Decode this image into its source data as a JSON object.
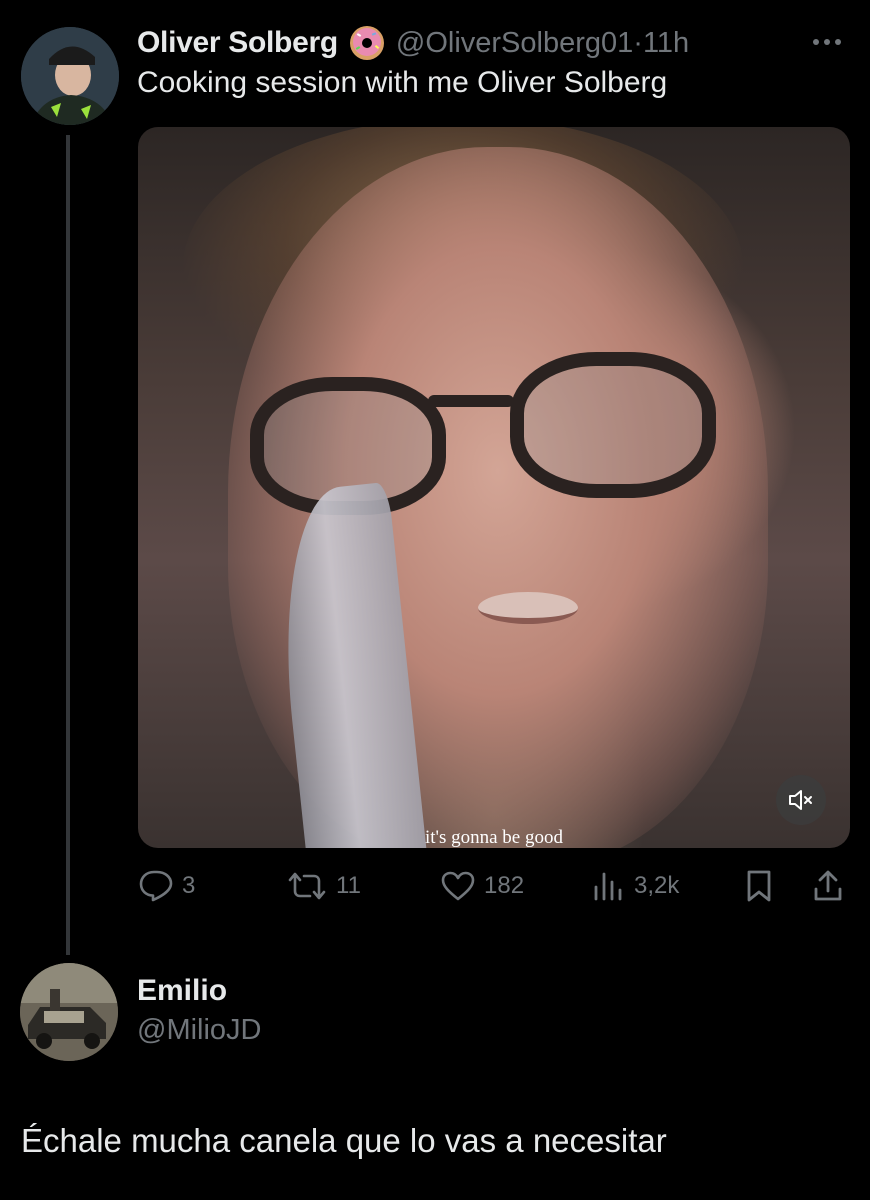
{
  "tweet": {
    "author_name": "Oliver Solberg",
    "handle": "@OliverSolberg01",
    "separator": "·",
    "time": "11h",
    "text": "Cooking session with me Oliver Solberg",
    "media": {
      "caption": "it's gonna be good"
    },
    "actions": {
      "replies": "3",
      "reposts": "11",
      "likes": "182",
      "views": "3,2k"
    }
  },
  "reply": {
    "author_name": "Emilio",
    "handle": "@MilioJD",
    "text": "Échale mucha canela que lo vas a necesitar"
  },
  "colors": {
    "background": "#000000",
    "primary_text": "#e7e9ea",
    "secondary_text": "#71767b",
    "thread_line": "#333639"
  },
  "icons": {
    "author_badge": "donut-emoji-icon",
    "more": "ellipsis-icon",
    "mute": "speaker-muted-icon",
    "reply": "speech-bubble-icon",
    "repost": "repost-arrows-icon",
    "like": "heart-icon",
    "views": "bar-chart-icon",
    "bookmark": "bookmark-icon",
    "share": "share-upload-icon"
  }
}
